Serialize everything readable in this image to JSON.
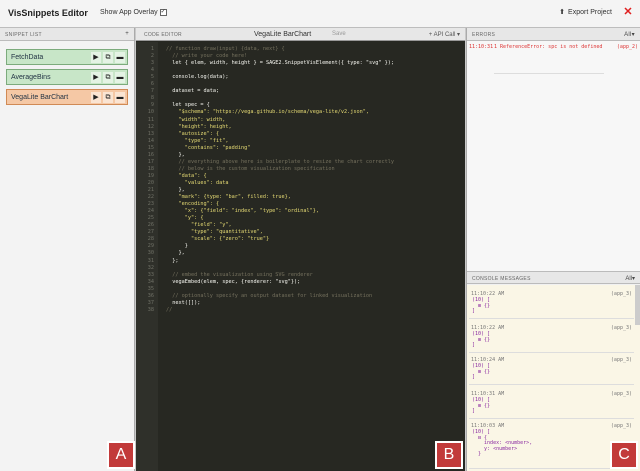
{
  "app": {
    "title": "VisSnippets Editor",
    "overlay_label": "Show App Overlay",
    "overlay_check": "✓",
    "export_label": "Export Project",
    "close_glyph": "✕"
  },
  "snippet_list": {
    "header": "SNIPPET LIST",
    "add_glyph": "+",
    "items": [
      {
        "name": "FetchData"
      },
      {
        "name": "AverageBins"
      },
      {
        "name": "VegaLite BarChart"
      }
    ],
    "btn_run": "▶",
    "btn_copy": "⧉",
    "btn_folder": "▬"
  },
  "editor": {
    "header": "CODE EDITOR",
    "filename": "VegaLite BarChart",
    "save_label": "Save",
    "api_label": "+ API Call ▾",
    "lines": [
      {
        "n": "1",
        "t": "// function draw(input) {data, next} {"
      },
      {
        "n": "2",
        "t": "  // write your code here!"
      },
      {
        "n": "3",
        "t": "  let { elem, width, height } = SAGE2.SnippetVisElement({ type: \"svg\" });"
      },
      {
        "n": "4",
        "t": ""
      },
      {
        "n": "5",
        "t": "  console.log(data);"
      },
      {
        "n": "6",
        "t": ""
      },
      {
        "n": "7",
        "t": "  dataset = data;"
      },
      {
        "n": "8",
        "t": ""
      },
      {
        "n": "9",
        "t": "  let spec = {"
      },
      {
        "n": "10",
        "t": "    \"$schema\": \"https://vega.github.io/schema/vega-lite/v2.json\","
      },
      {
        "n": "11",
        "t": "    \"width\": width,"
      },
      {
        "n": "12",
        "t": "    \"height\": height,"
      },
      {
        "n": "13",
        "t": "    \"autosize\": {"
      },
      {
        "n": "14",
        "t": "      \"type\": \"fit\","
      },
      {
        "n": "15",
        "t": "      \"contains\": \"padding\""
      },
      {
        "n": "16",
        "t": "    },"
      },
      {
        "n": "17",
        "t": "    // everything above here is boilerplate to resize the chart correctly"
      },
      {
        "n": "18",
        "t": "    // below is the custom visualization specification"
      },
      {
        "n": "19",
        "t": "    \"data\": {"
      },
      {
        "n": "20",
        "t": "      \"values\": data"
      },
      {
        "n": "21",
        "t": "    },"
      },
      {
        "n": "22",
        "t": "    \"mark\": {type: \"bar\", filled: true},"
      },
      {
        "n": "23",
        "t": "    \"encoding\": {"
      },
      {
        "n": "24",
        "t": "      \"x\": {\"field\": \"index\", \"type\": \"ordinal\"},"
      },
      {
        "n": "25",
        "t": "      \"y\": {"
      },
      {
        "n": "26",
        "t": "        \"field\": \"y\","
      },
      {
        "n": "27",
        "t": "        \"type\": \"quantitative\","
      },
      {
        "n": "28",
        "t": "        \"scale\": {\"zero\": \"true\"}"
      },
      {
        "n": "29",
        "t": "      }"
      },
      {
        "n": "30",
        "t": "    },"
      },
      {
        "n": "31",
        "t": "  };"
      },
      {
        "n": "32",
        "t": ""
      },
      {
        "n": "33",
        "t": "  // embed the visualization using SVG renderer"
      },
      {
        "n": "34",
        "t": "  vegaEmbed(elem, spec, {renderer: \"svg\"});"
      },
      {
        "n": "35",
        "t": ""
      },
      {
        "n": "36",
        "t": "  // optionally specify an output dataset for linked visualization"
      },
      {
        "n": "37",
        "t": "  next([]);"
      },
      {
        "n": "38",
        "t": "//"
      }
    ]
  },
  "errors": {
    "header": "ERRORS",
    "action": "All▾",
    "items": [
      {
        "ts": "11:10:31",
        "msg": "1 ReferenceError: spc is not defined",
        "src": "(app_2)"
      }
    ]
  },
  "console": {
    "header": "CONSOLE MESSAGES",
    "action": "All▾",
    "items": [
      {
        "ts": "11:10:22 AM",
        "src": "(app_3)",
        "body": "(10) [\n  ⊞ {}\n]"
      },
      {
        "ts": "11:10:22 AM",
        "src": "(app_3)",
        "body": "(10) [\n  ⊞ {}\n]"
      },
      {
        "ts": "11:10:24 AM",
        "src": "(app_3)",
        "body": "(10) [\n  ⊞ {}\n]"
      },
      {
        "ts": "11:10:31 AM",
        "src": "(app_3)",
        "body": "(10) [\n  ⊞ {}\n]"
      },
      {
        "ts": "11:10:03 AM",
        "src": "(app_3)",
        "body": "(10) [\n  ⊟ {\n    index: <number>,\n    y: <number>\n  }"
      }
    ]
  },
  "badges": {
    "a": "A",
    "b": "B",
    "c": "C"
  }
}
